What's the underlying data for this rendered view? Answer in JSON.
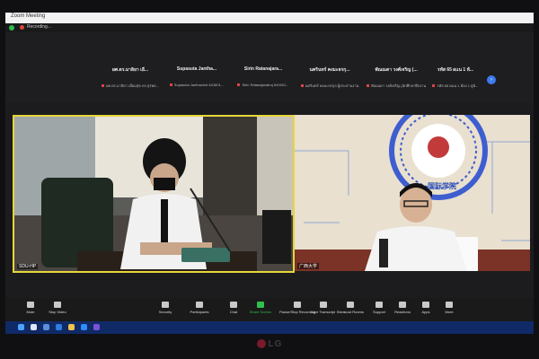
{
  "window": {
    "title": "Zoom Meeting"
  },
  "status": {
    "recording_label": "Recording..."
  },
  "participants_strip": [
    {
      "name": "ผศ.ดร.มาลิยา เอี...",
      "subtitle": "ผศ.ดร.มาลิยา เอี่ยมสุข ดร.สุรพล..."
    },
    {
      "name": "Supasuta Jantha...",
      "subtitle": "Supasuta Janthachot 641601..."
    },
    {
      "name": "Sirin Ratanajara...",
      "subtitle": "Sirin Ratanajaratroj 641601..."
    },
    {
      "name": "นครินทร์ คงมะลรกุ...",
      "subtitle": "นครินทร์ คงมะลรกุล ผู้ประสานงาน"
    },
    {
      "name": "พัณณดา วงศ์เจริญ (...",
      "subtitle": "พัณณดา วงศ์เจริญ (นักศึกษาฝึกงาน)"
    },
    {
      "name": "รหัส 65 ผเเน 1 ห้...",
      "subtitle": "รหัส 65 ผเเน 1 ห้อง 1 ยูนิ..."
    }
  ],
  "video_tiles": [
    {
      "label": "SDU-HP"
    },
    {
      "label": "广西大学"
    }
  ],
  "backdrop_text": {
    "emblem_cn": "广西大学 国际学院",
    "caption_cn": "国际学院"
  },
  "toolbar": [
    {
      "label": "Mute",
      "icon": "mic-icon"
    },
    {
      "label": "Stop Video",
      "icon": "camera-icon"
    },
    {
      "label": "Security",
      "icon": "shield-icon"
    },
    {
      "label": "Participants",
      "icon": "people-icon",
      "count": "38"
    },
    {
      "label": "Chat",
      "icon": "chat-icon"
    },
    {
      "label": "Share Screen",
      "icon": "share-icon"
    },
    {
      "label": "Pause/Stop Recording",
      "icon": "record-icon"
    },
    {
      "label": "Live Transcript",
      "icon": "cc-icon"
    },
    {
      "label": "Breakout Rooms",
      "icon": "grid-icon"
    },
    {
      "label": "Support",
      "icon": "support-icon"
    },
    {
      "label": "Reactions",
      "icon": "smile-icon"
    },
    {
      "label": "Apps",
      "icon": "apps-icon"
    },
    {
      "label": "More",
      "icon": "more-icon"
    }
  ],
  "monitor": {
    "brand": "LG"
  },
  "colors": {
    "active_speaker": "#e7d63a",
    "taskbar": "#0f2a66",
    "share_green": "#2fbf4d"
  }
}
